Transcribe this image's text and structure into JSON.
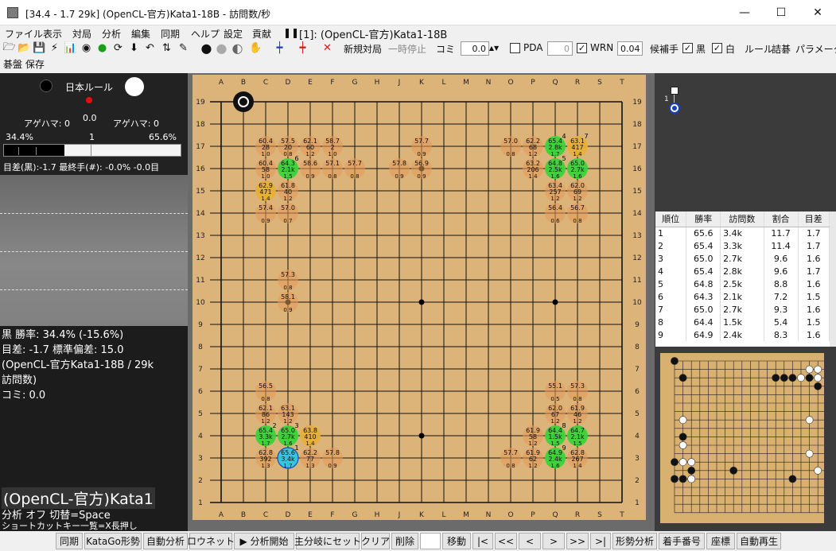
{
  "window": {
    "title": "[34.4 - 1.7 29k] (OpenCL-官方)Kata1-18B - 訪問数/秒",
    "minimize": "—",
    "maximize": "☐",
    "close": "✕"
  },
  "menu": [
    "ファイル",
    "表示",
    "対局",
    "分析",
    "編集",
    "同期",
    "ヘルプ",
    "設定",
    "貢献"
  ],
  "toolbar": {
    "engine_label": "[1]: (OpenCL-官方)Kata1-18B",
    "new_game": "新規対局",
    "pause": "一時停止",
    "komi_label": "コミ",
    "komi_value": "0.0",
    "pda_label": "PDA",
    "pda_value": "0",
    "wrn_label": "WRN",
    "wrn_value": "0.04",
    "candidates_label": "候補手",
    "black_label": "黒",
    "white_label": "白",
    "rule_label": "ルール",
    "tsumego_label": "詰碁",
    "params_label": "パラメータ",
    "row2_a": "碁盤",
    "row2_b": "保存"
  },
  "left": {
    "rule": "日本ルール",
    "score": "0.0",
    "captures_black": "アゲハマ: 0",
    "captures_white": "アゲハマ: 0",
    "winrate_black": "34.4%",
    "winrate_white": "65.6%",
    "move_number": "1",
    "lead_text": "目差(黒):-1.7 最終手(#): -0.0% -0.0目",
    "info1": "黒 勝率: 34.4% (-15.6%)",
    "info2": "目差: -1.7 標準偏差: 15.0",
    "info3": "(OpenCL-官方Kata1-18B / 29k",
    "info4": "訪問数)",
    "info5": "コミ: 0.0",
    "engine_big": "(OpenCL-官方)Kata1",
    "analysis_status": "分析 オフ  切替=Space",
    "shortcut": "ショートカットキー一覧=X長押し"
  },
  "board": {
    "cols": [
      "A",
      "B",
      "C",
      "D",
      "E",
      "F",
      "G",
      "H",
      "J",
      "K",
      "L",
      "M",
      "N",
      "O",
      "P",
      "Q",
      "R",
      "S",
      "T"
    ],
    "rows": [
      "19",
      "18",
      "17",
      "16",
      "15",
      "14",
      "13",
      "12",
      "11",
      "10",
      "9",
      "8",
      "7",
      "6",
      "5",
      "4",
      "3",
      "2",
      "1"
    ],
    "stones": [
      {
        "color": "white",
        "pt": "B19",
        "last": true
      }
    ],
    "candidates": [
      {
        "pt": "C17",
        "w": "60.4",
        "v": "28",
        "s": "1.0",
        "c": "o"
      },
      {
        "pt": "D17",
        "w": "57.5",
        "v": "20",
        "s": "0.8",
        "c": "o"
      },
      {
        "pt": "E17",
        "w": "62.1",
        "v": "60",
        "s": "1.2",
        "c": "o"
      },
      {
        "pt": "F17",
        "w": "58.7",
        "v": "2",
        "s": "1.0",
        "c": "o"
      },
      {
        "pt": "K17",
        "w": "57.7",
        "v": "",
        "s": "0.9",
        "c": "o"
      },
      {
        "pt": "O17",
        "w": "57.0",
        "v": "",
        "s": "0.8",
        "c": "o"
      },
      {
        "pt": "P17",
        "w": "62.2",
        "v": "68",
        "s": "1.2",
        "c": "o"
      },
      {
        "pt": "Q17",
        "w": "65.4",
        "v": "2.8k",
        "s": "1.7",
        "c": "g",
        "r": "4"
      },
      {
        "pt": "R17",
        "w": "63.1",
        "v": "417",
        "s": "1.4",
        "c": "y",
        "r": "7"
      },
      {
        "pt": "C16",
        "w": "60.4",
        "v": "58",
        "s": "1.0",
        "c": "o"
      },
      {
        "pt": "D16",
        "w": "64.3",
        "v": "2.1k",
        "s": "1.5",
        "c": "g",
        "r": "6"
      },
      {
        "pt": "E16",
        "w": "58.6",
        "v": "",
        "s": "0.9",
        "c": "o"
      },
      {
        "pt": "F16",
        "w": "57.1",
        "v": "",
        "s": "0.8",
        "c": "o"
      },
      {
        "pt": "G16",
        "w": "57.7",
        "v": "",
        "s": "0.8",
        "c": "o"
      },
      {
        "pt": "J16",
        "w": "57.8",
        "v": "",
        "s": "0.9",
        "c": "o"
      },
      {
        "pt": "K16",
        "w": "56.9",
        "v": "",
        "s": "0.9",
        "c": "o"
      },
      {
        "pt": "P16",
        "w": "63.2",
        "v": "206",
        "s": "1.4",
        "c": "o"
      },
      {
        "pt": "Q16",
        "w": "64.8",
        "v": "2.5k",
        "s": "1.6",
        "c": "g",
        "r": "5"
      },
      {
        "pt": "R16",
        "w": "65.0",
        "v": "2.7k",
        "s": "1.6",
        "c": "g"
      },
      {
        "pt": "C15",
        "w": "62.9",
        "v": "471",
        "s": "1.4",
        "c": "y"
      },
      {
        "pt": "D15",
        "w": "61.8",
        "v": "40",
        "s": "1.2",
        "c": "o"
      },
      {
        "pt": "Q15",
        "w": "63.4",
        "v": "257",
        "s": "1.2",
        "c": "o"
      },
      {
        "pt": "R15",
        "w": "62.0",
        "v": "69",
        "s": "1.2",
        "c": "o"
      },
      {
        "pt": "C14",
        "w": "57.4",
        "v": "",
        "s": "0.9",
        "c": "o"
      },
      {
        "pt": "D14",
        "w": "57.0",
        "v": "",
        "s": "0.7",
        "c": "o"
      },
      {
        "pt": "Q14",
        "w": "56.4",
        "v": "",
        "s": "0.6",
        "c": "o"
      },
      {
        "pt": "R14",
        "w": "56.7",
        "v": "",
        "s": "0.8",
        "c": "o"
      },
      {
        "pt": "D11",
        "w": "57.3",
        "v": "",
        "s": "0.8",
        "c": "o"
      },
      {
        "pt": "D10",
        "w": "58.1",
        "v": "",
        "s": "0.9",
        "c": "o"
      },
      {
        "pt": "C6",
        "w": "56.5",
        "v": "",
        "s": "0.8",
        "c": "o"
      },
      {
        "pt": "Q6",
        "w": "55.1",
        "v": "",
        "s": "0.5",
        "c": "o"
      },
      {
        "pt": "R6",
        "w": "57.3",
        "v": "",
        "s": "0.8",
        "c": "o"
      },
      {
        "pt": "C5",
        "w": "62.1",
        "v": "86",
        "s": "1.2",
        "c": "o"
      },
      {
        "pt": "D5",
        "w": "63.1",
        "v": "143",
        "s": "1.2",
        "c": "o"
      },
      {
        "pt": "Q5",
        "w": "62.0",
        "v": "67",
        "s": "1.2",
        "c": "o"
      },
      {
        "pt": "R5",
        "w": "61.9",
        "v": "46",
        "s": "1.2",
        "c": "o"
      },
      {
        "pt": "C4",
        "w": "65.4",
        "v": "3.3k",
        "s": "1.7",
        "c": "g",
        "r": "2"
      },
      {
        "pt": "D4",
        "w": "65.0",
        "v": "2.7k",
        "s": "1.6",
        "c": "g",
        "r": "3"
      },
      {
        "pt": "E4",
        "w": "63.8",
        "v": "410",
        "s": "1.4",
        "c": "y"
      },
      {
        "pt": "P4",
        "w": "61.9",
        "v": "58",
        "s": "1.2",
        "c": "o"
      },
      {
        "pt": "Q4",
        "w": "64.4",
        "v": "1.5k",
        "s": "1.5",
        "c": "g",
        "r": "8"
      },
      {
        "pt": "R4",
        "w": "64.7",
        "v": "2.1k",
        "s": "1.5",
        "c": "g"
      },
      {
        "pt": "C3",
        "w": "62.8",
        "v": "392",
        "s": "1.3",
        "c": "o"
      },
      {
        "pt": "D3",
        "w": "65.6",
        "v": "3.4k",
        "s": "1.7",
        "c": "b",
        "r": "1"
      },
      {
        "pt": "E3",
        "w": "62.2",
        "v": "77",
        "s": "1.3",
        "c": "o"
      },
      {
        "pt": "F3",
        "w": "57.8",
        "v": "",
        "s": "0.9",
        "c": "o"
      },
      {
        "pt": "O3",
        "w": "57.7",
        "v": "",
        "s": "0.8",
        "c": "o"
      },
      {
        "pt": "P3",
        "w": "61.9",
        "v": "62",
        "s": "1.2",
        "c": "o"
      },
      {
        "pt": "Q3",
        "w": "64.9",
        "v": "2.4k",
        "s": "1.6",
        "c": "g",
        "r": "9"
      },
      {
        "pt": "R3",
        "w": "62.8",
        "v": "267",
        "s": "1.4",
        "c": "o"
      }
    ],
    "colors": {
      "board": "#dcb479",
      "line": "#111",
      "g": "#3ad33a",
      "y": "#e6b03a",
      "o": "#e59a5a",
      "b": "#2fc6e8"
    }
  },
  "variation_tree": {
    "node_label": "1"
  },
  "table": {
    "headers": [
      "順位",
      "勝率",
      "訪問数",
      "割合",
      "目差"
    ],
    "rows": [
      [
        "1",
        "65.6",
        "3.4k",
        "11.7",
        "1.7"
      ],
      [
        "2",
        "65.4",
        "3.3k",
        "11.4",
        "1.7"
      ],
      [
        "3",
        "65.0",
        "2.7k",
        "9.6",
        "1.6"
      ],
      [
        "4",
        "65.4",
        "2.8k",
        "9.6",
        "1.7"
      ],
      [
        "5",
        "64.8",
        "2.5k",
        "8.8",
        "1.6"
      ],
      [
        "6",
        "64.3",
        "2.1k",
        "7.2",
        "1.5"
      ],
      [
        "7",
        "65.0",
        "2.7k",
        "9.3",
        "1.6"
      ],
      [
        "8",
        "64.4",
        "1.5k",
        "5.4",
        "1.5"
      ],
      [
        "9",
        "64.9",
        "2.4k",
        "8.3",
        "1.6"
      ]
    ]
  },
  "minimap": {
    "stones": [
      {
        "c": "black",
        "pt": "A19"
      },
      {
        "c": "black",
        "pt": "B17"
      },
      {
        "c": "white",
        "pt": "S18"
      },
      {
        "c": "white",
        "pt": "R18"
      },
      {
        "c": "white",
        "pt": "Q17"
      },
      {
        "c": "black",
        "pt": "N17"
      },
      {
        "c": "black",
        "pt": "O17"
      },
      {
        "c": "black",
        "pt": "P17"
      },
      {
        "c": "black",
        "pt": "R17"
      },
      {
        "c": "white",
        "pt": "S17"
      },
      {
        "c": "black",
        "pt": "S16"
      },
      {
        "c": "white",
        "pt": "B12"
      },
      {
        "c": "white",
        "pt": "R12"
      },
      {
        "c": "black",
        "pt": "B10"
      },
      {
        "c": "white",
        "pt": "B9"
      },
      {
        "c": "white",
        "pt": "R8"
      },
      {
        "c": "black",
        "pt": "A7"
      },
      {
        "c": "white",
        "pt": "B7"
      },
      {
        "c": "white",
        "pt": "C7"
      },
      {
        "c": "black",
        "pt": "C6"
      },
      {
        "c": "black",
        "pt": "H6"
      },
      {
        "c": "white",
        "pt": "S6"
      },
      {
        "c": "black",
        "pt": "A5"
      },
      {
        "c": "black",
        "pt": "B5"
      },
      {
        "c": "white",
        "pt": "C5"
      },
      {
        "c": "black",
        "pt": "P5"
      }
    ]
  },
  "bottom": [
    "同期",
    "KataGo形勢",
    "自動分析",
    "ロウネット",
    "▶ 分析開始",
    "主分岐にセット",
    "クリア",
    "削除",
    "",
    "移動",
    "|<",
    "<<",
    "<",
    ">",
    ">>",
    ">|",
    "形勢分析",
    "着手番号",
    "座標",
    "自動再生"
  ]
}
